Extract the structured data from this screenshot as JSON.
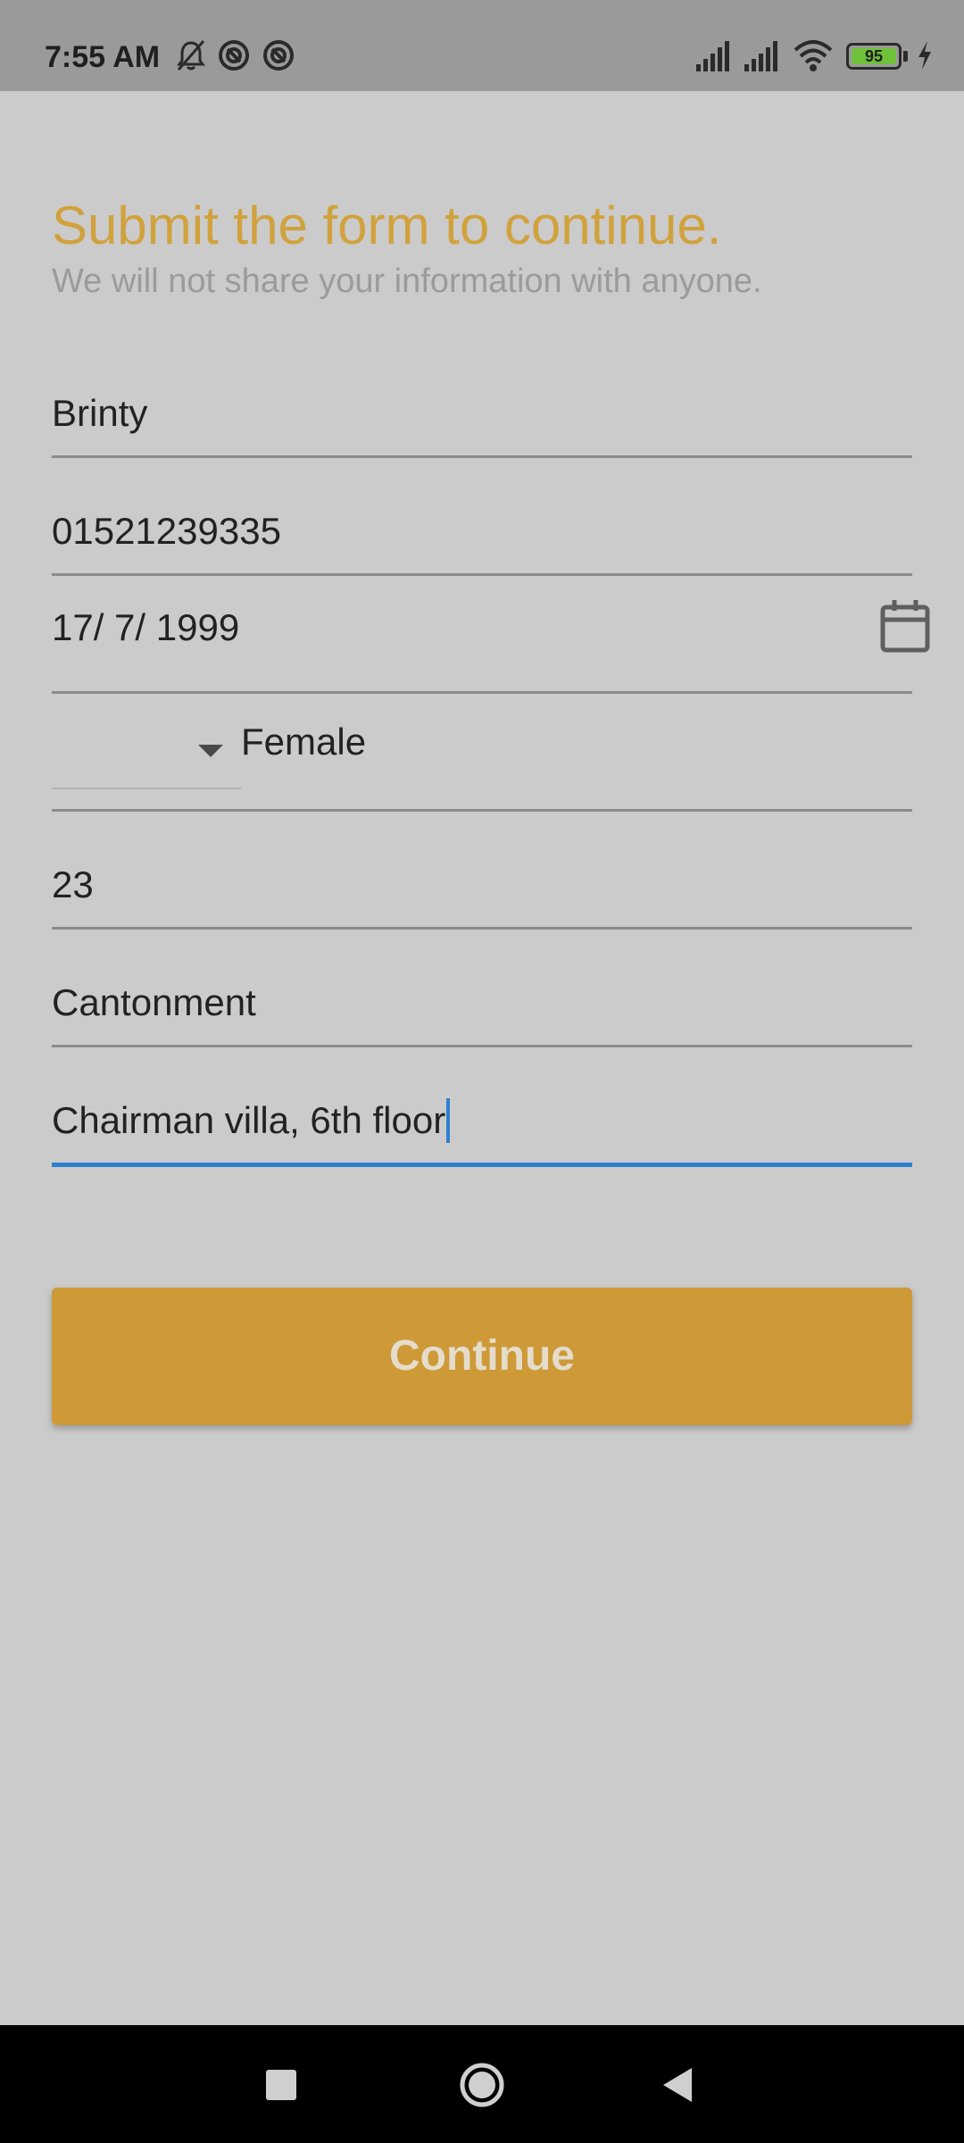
{
  "status_bar": {
    "time": "7:55 AM",
    "battery_level": "95",
    "icons": [
      "bell-off-icon",
      "sync-icon",
      "sync-icon",
      "signal-icon",
      "signal-icon",
      "wifi-icon",
      "battery-icon",
      "charging-icon"
    ]
  },
  "form": {
    "title": "Submit the form to continue.",
    "subtitle": "We will not share your information with anyone.",
    "fields": {
      "name": "Brinty",
      "phone": "01521239335",
      "dob": "17/ 7/ 1999",
      "gender": "Female",
      "age": "23",
      "area": "Cantonment",
      "address": "Chairman villa, 6th floor"
    },
    "continue_label": "Continue"
  },
  "colors": {
    "accent": "#d1a23c",
    "button": "#cd9a37",
    "focus": "#2f7fcf",
    "background": "#cbcbcb"
  },
  "nav_bar": {
    "icons": [
      "recents-icon",
      "home-icon",
      "back-icon"
    ]
  }
}
